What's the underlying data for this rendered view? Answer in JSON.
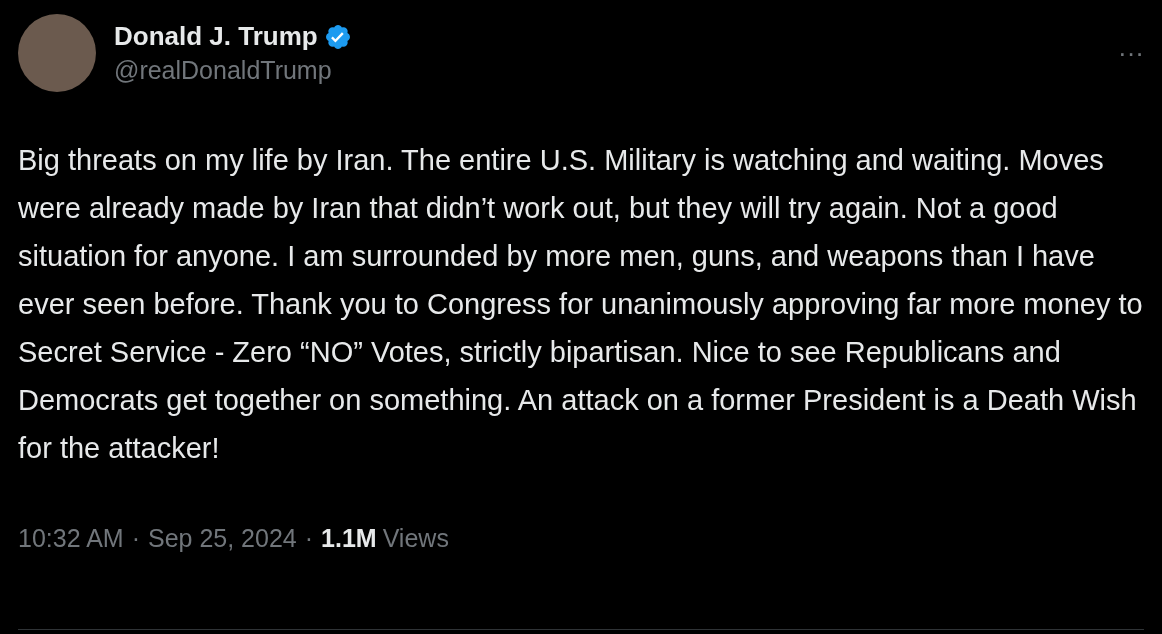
{
  "author": {
    "name": "Donald J. Trump",
    "verified": true,
    "handle": "@realDonaldTrump"
  },
  "more": "···",
  "text": "Big threats on my life by Iran. The entire U.S. Military is watching and waiting. Moves were already made by Iran that didn’t work out, but they will try again. Not a good situation for anyone. I am surrounded by more men, guns, and weapons than I have ever seen before. Thank you to Congress for unanimously approving far more money to Secret Service - Zero “NO” Votes, strictly bipartisan. Nice to see Republicans and Democrats get together on something. An attack on a former President is a Death Wish for the attacker!",
  "footer": {
    "time": "10:32 AM",
    "separator_1": "·",
    "date": "Sep 25, 2024",
    "separator_2": "·",
    "views_count": "1.1M",
    "views_label": "Views"
  }
}
